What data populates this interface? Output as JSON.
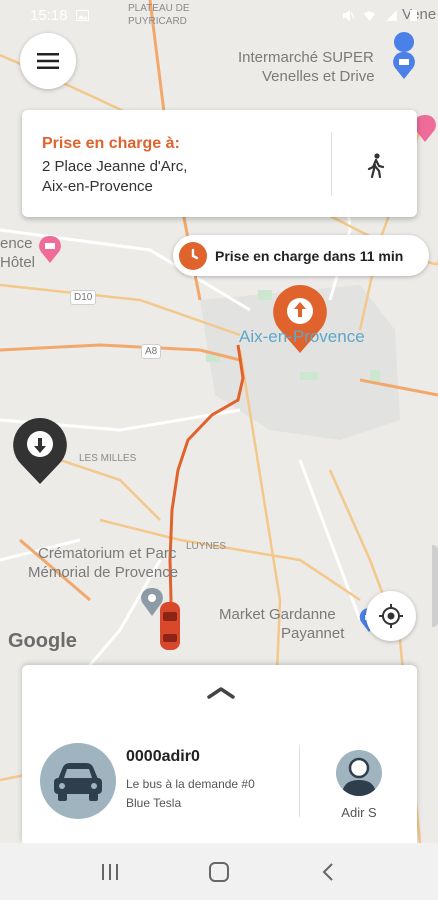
{
  "status_bar": {
    "time": "15:18"
  },
  "map": {
    "labels": {
      "plateau": "PLATEAU DE",
      "puyricard": "PUYRICARD",
      "intermarche_1": "Intermarché SUPER",
      "intermarche_2": "Venelles et Drive",
      "hotel_1": "ence",
      "hotel_2": "Hôtel",
      "city": "Aix-en-Provence",
      "les_milles": "LES MILLES",
      "crematorium_1": "Crématorium et Parc",
      "crematorium_2": "Mémorial de Provence",
      "luynes": "LUYNES",
      "market_1": "Market Gardanne",
      "market_2": "Payannet",
      "google": "Google",
      "venelles_partial": "Vene",
      "road_d10": "D10",
      "road_a8": "A8"
    }
  },
  "pickup": {
    "title": "Prise en charge à:",
    "address_line1": "2 Place Jeanne d'Arc,",
    "address_line2": "Aix-en-Provence"
  },
  "eta": {
    "text": "Prise en charge dans 11 min"
  },
  "vehicle": {
    "name": "0000adir0",
    "line": "Le bus à la demande #0",
    "model": "Blue Tesla"
  },
  "driver": {
    "name": "Adir S"
  },
  "colors": {
    "accent": "#e0622d",
    "avatar_bg": "#9fb4bf"
  }
}
